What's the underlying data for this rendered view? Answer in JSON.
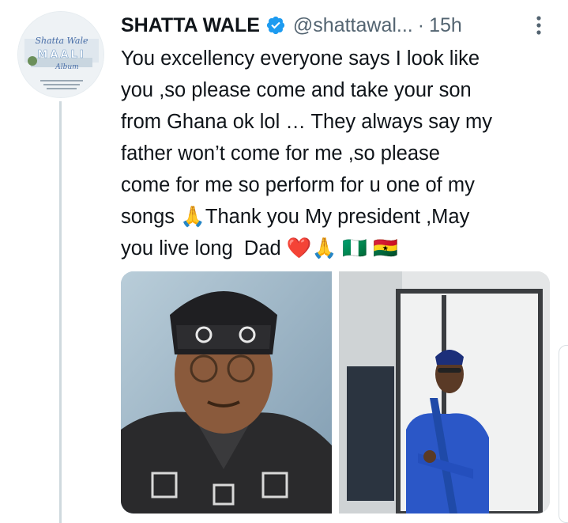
{
  "author": {
    "name": "SHATTA WALE",
    "handle": "@shattawal...",
    "separator": "·",
    "time": "15h",
    "avatar_text": {
      "line1": "Shatta Wale",
      "line2": "MAALI",
      "line3": "Album"
    }
  },
  "tweet": {
    "text": "You excellency everyone says I look like\nyou ,so please come and take your son\nfrom Ghana ok lol … They always say my\nfather won’t come for me ,so please\ncome for me so perform for u one of my\nsongs 🙏Thank you My president ,May\nyou live long  Dad ❤️🙏 🇳🇬 🇬🇭"
  },
  "icons": {
    "verified": "verified-badge-icon",
    "more": "more-options-icon"
  },
  "colors": {
    "verified_blue": "#1d9bf0",
    "secondary_text": "#536471",
    "thread_line": "#cfd9de"
  }
}
